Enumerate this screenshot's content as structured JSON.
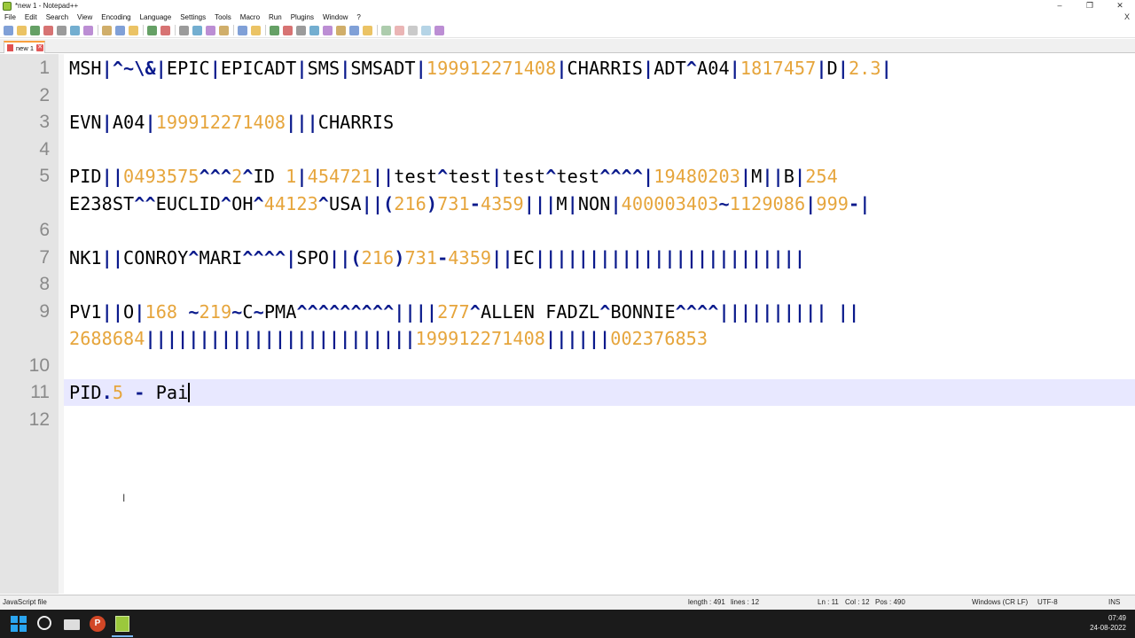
{
  "window": {
    "title": "*new 1 - Notepad++",
    "controls": [
      "–",
      "❐",
      "✕"
    ]
  },
  "menu": {
    "items": [
      "File",
      "Edit",
      "Search",
      "View",
      "Encoding",
      "Language",
      "Settings",
      "Tools",
      "Macro",
      "Run",
      "Plugins",
      "Window",
      "?"
    ],
    "close": "X"
  },
  "toolbar": {
    "icons": [
      "new-file-icon",
      "open-file-icon",
      "save-icon",
      "save-all-icon",
      "close-icon",
      "close-all-icon",
      "print-icon",
      "cut-icon",
      "copy-icon",
      "paste-icon",
      "undo-icon",
      "redo-icon",
      "find-icon",
      "replace-icon",
      "zoom-in-icon",
      "zoom-out-icon",
      "sync-v-icon",
      "sync-h-icon",
      "word-wrap-icon",
      "all-chars-icon",
      "indent-guide-icon",
      "udl-icon",
      "doc-map-icon",
      "function-list-icon",
      "folder-workspace-icon",
      "monitoring-icon",
      "record-macro-icon",
      "stop-record-icon",
      "play-macro-icon",
      "run-macro-multiple-icon",
      "save-macro-icon"
    ]
  },
  "tabs": [
    {
      "label": "new 1",
      "close": "✕"
    }
  ],
  "editor": {
    "lines": [
      {
        "num": "1",
        "tokens": [
          [
            "t",
            "MSH"
          ],
          [
            "o",
            "|^~\\&|"
          ],
          [
            "t",
            "EPIC"
          ],
          [
            "o",
            "|"
          ],
          [
            "t",
            "EPICADT"
          ],
          [
            "o",
            "|"
          ],
          [
            "t",
            "SMS"
          ],
          [
            "o",
            "|"
          ],
          [
            "t",
            "SMSADT"
          ],
          [
            "o",
            "|"
          ],
          [
            "n",
            "199912271408"
          ],
          [
            "o",
            "|"
          ],
          [
            "t",
            "CHARRIS"
          ],
          [
            "o",
            "|"
          ],
          [
            "t",
            "ADT"
          ],
          [
            "o",
            "^"
          ],
          [
            "t",
            "A04"
          ],
          [
            "o",
            "|"
          ],
          [
            "n",
            "1817457"
          ],
          [
            "o",
            "|"
          ],
          [
            "t",
            "D"
          ],
          [
            "o",
            "|"
          ],
          [
            "n",
            "2.3"
          ],
          [
            "o",
            "|"
          ]
        ]
      },
      {
        "num": "2",
        "tokens": []
      },
      {
        "num": "3",
        "tokens": [
          [
            "t",
            "EVN"
          ],
          [
            "o",
            "|"
          ],
          [
            "t",
            "A04"
          ],
          [
            "o",
            "|"
          ],
          [
            "n",
            "199912271408"
          ],
          [
            "o",
            "|||"
          ],
          [
            "t",
            "CHARRIS"
          ]
        ]
      },
      {
        "num": "4",
        "tokens": []
      },
      {
        "num": "5",
        "tokens": [
          [
            "t",
            "PID"
          ],
          [
            "o",
            "||"
          ],
          [
            "n",
            "0493575"
          ],
          [
            "o",
            "^^^"
          ],
          [
            "n",
            "2"
          ],
          [
            "o",
            "^"
          ],
          [
            "t",
            "ID "
          ],
          [
            "n",
            "1"
          ],
          [
            "o",
            "|"
          ],
          [
            "n",
            "454721"
          ],
          [
            "o",
            "||"
          ],
          [
            "t",
            "test"
          ],
          [
            "o",
            "^"
          ],
          [
            "t",
            "test"
          ],
          [
            "o",
            "|"
          ],
          [
            "t",
            "test"
          ],
          [
            "o",
            "^"
          ],
          [
            "t",
            "test"
          ],
          [
            "o",
            "^^^^|"
          ],
          [
            "n",
            "19480203"
          ],
          [
            "o",
            "|"
          ],
          [
            "t",
            "M"
          ],
          [
            "o",
            "||"
          ],
          [
            "t",
            "B"
          ],
          [
            "o",
            "|"
          ],
          [
            "n",
            "254"
          ]
        ]
      },
      {
        "num": "",
        "tokens": [
          [
            "t",
            "E238ST"
          ],
          [
            "o",
            "^^"
          ],
          [
            "t",
            "EUCLID"
          ],
          [
            "o",
            "^"
          ],
          [
            "t",
            "OH"
          ],
          [
            "o",
            "^"
          ],
          [
            "n",
            "44123"
          ],
          [
            "o",
            "^"
          ],
          [
            "t",
            "USA"
          ],
          [
            "o",
            "||("
          ],
          [
            "n",
            "216"
          ],
          [
            "o",
            ")"
          ],
          [
            "n",
            "731"
          ],
          [
            "o",
            "-"
          ],
          [
            "n",
            "4359"
          ],
          [
            "o",
            "|||"
          ],
          [
            "t",
            "M"
          ],
          [
            "o",
            "|"
          ],
          [
            "t",
            "NON"
          ],
          [
            "o",
            "|"
          ],
          [
            "n",
            "400003403"
          ],
          [
            "o",
            "~"
          ],
          [
            "n",
            "1129086"
          ],
          [
            "o",
            "|"
          ],
          [
            "n",
            "999"
          ],
          [
            "o",
            "-|"
          ]
        ]
      },
      {
        "num": "6",
        "tokens": []
      },
      {
        "num": "7",
        "tokens": [
          [
            "t",
            "NK1"
          ],
          [
            "o",
            "||"
          ],
          [
            "t",
            "CONROY"
          ],
          [
            "o",
            "^"
          ],
          [
            "t",
            "MARI"
          ],
          [
            "o",
            "^^^^|"
          ],
          [
            "t",
            "SPO"
          ],
          [
            "o",
            "||("
          ],
          [
            "n",
            "216"
          ],
          [
            "o",
            ")"
          ],
          [
            "n",
            "731"
          ],
          [
            "o",
            "-"
          ],
          [
            "n",
            "4359"
          ],
          [
            "o",
            "||"
          ],
          [
            "t",
            "EC"
          ],
          [
            "o",
            "|||||||||||||||||||||||||"
          ]
        ]
      },
      {
        "num": "8",
        "tokens": []
      },
      {
        "num": "9",
        "tokens": [
          [
            "t",
            "PV1"
          ],
          [
            "o",
            "||"
          ],
          [
            "t",
            "O"
          ],
          [
            "o",
            "|"
          ],
          [
            "n",
            "168"
          ],
          [
            "t",
            " "
          ],
          [
            "o",
            "~"
          ],
          [
            "n",
            "219"
          ],
          [
            "o",
            "~"
          ],
          [
            "t",
            "C"
          ],
          [
            "o",
            "~"
          ],
          [
            "t",
            "PMA"
          ],
          [
            "o",
            "^^^^^^^^^|||"
          ],
          [
            "o",
            "|"
          ],
          [
            "n",
            "277"
          ],
          [
            "o",
            "^"
          ],
          [
            "t",
            "ALLEN FADZL"
          ],
          [
            "o",
            "^"
          ],
          [
            "t",
            "BONNIE"
          ],
          [
            "o",
            "^^^^||||||||||"
          ],
          [
            "t",
            " "
          ],
          [
            "o",
            "||"
          ]
        ]
      },
      {
        "num": "",
        "tokens": [
          [
            "n",
            "2688684"
          ],
          [
            "o",
            "|||||||||||||||||||||||||"
          ],
          [
            "n",
            "199912271408"
          ],
          [
            "o",
            "||||||"
          ],
          [
            "n",
            "002376853"
          ]
        ]
      },
      {
        "num": "10",
        "tokens": []
      },
      {
        "num": "11",
        "tokens": [
          [
            "t",
            "PID"
          ],
          [
            "o",
            "."
          ],
          [
            "n",
            "5"
          ],
          [
            "t",
            " "
          ],
          [
            "o",
            "-"
          ],
          [
            "t",
            " Pai"
          ]
        ],
        "current": true
      },
      {
        "num": "12",
        "tokens": []
      }
    ]
  },
  "status": {
    "filetype": "JavaScript file",
    "length": "length : 491",
    "lines": "lines : 12",
    "ln": "Ln : 11",
    "col": "Col : 12",
    "pos": "Pos : 490",
    "eol": "Windows (CR LF)",
    "encoding": "UTF-8",
    "mode": "INS"
  },
  "taskbar": {
    "time": "07:49",
    "date": "24-08-2022"
  }
}
